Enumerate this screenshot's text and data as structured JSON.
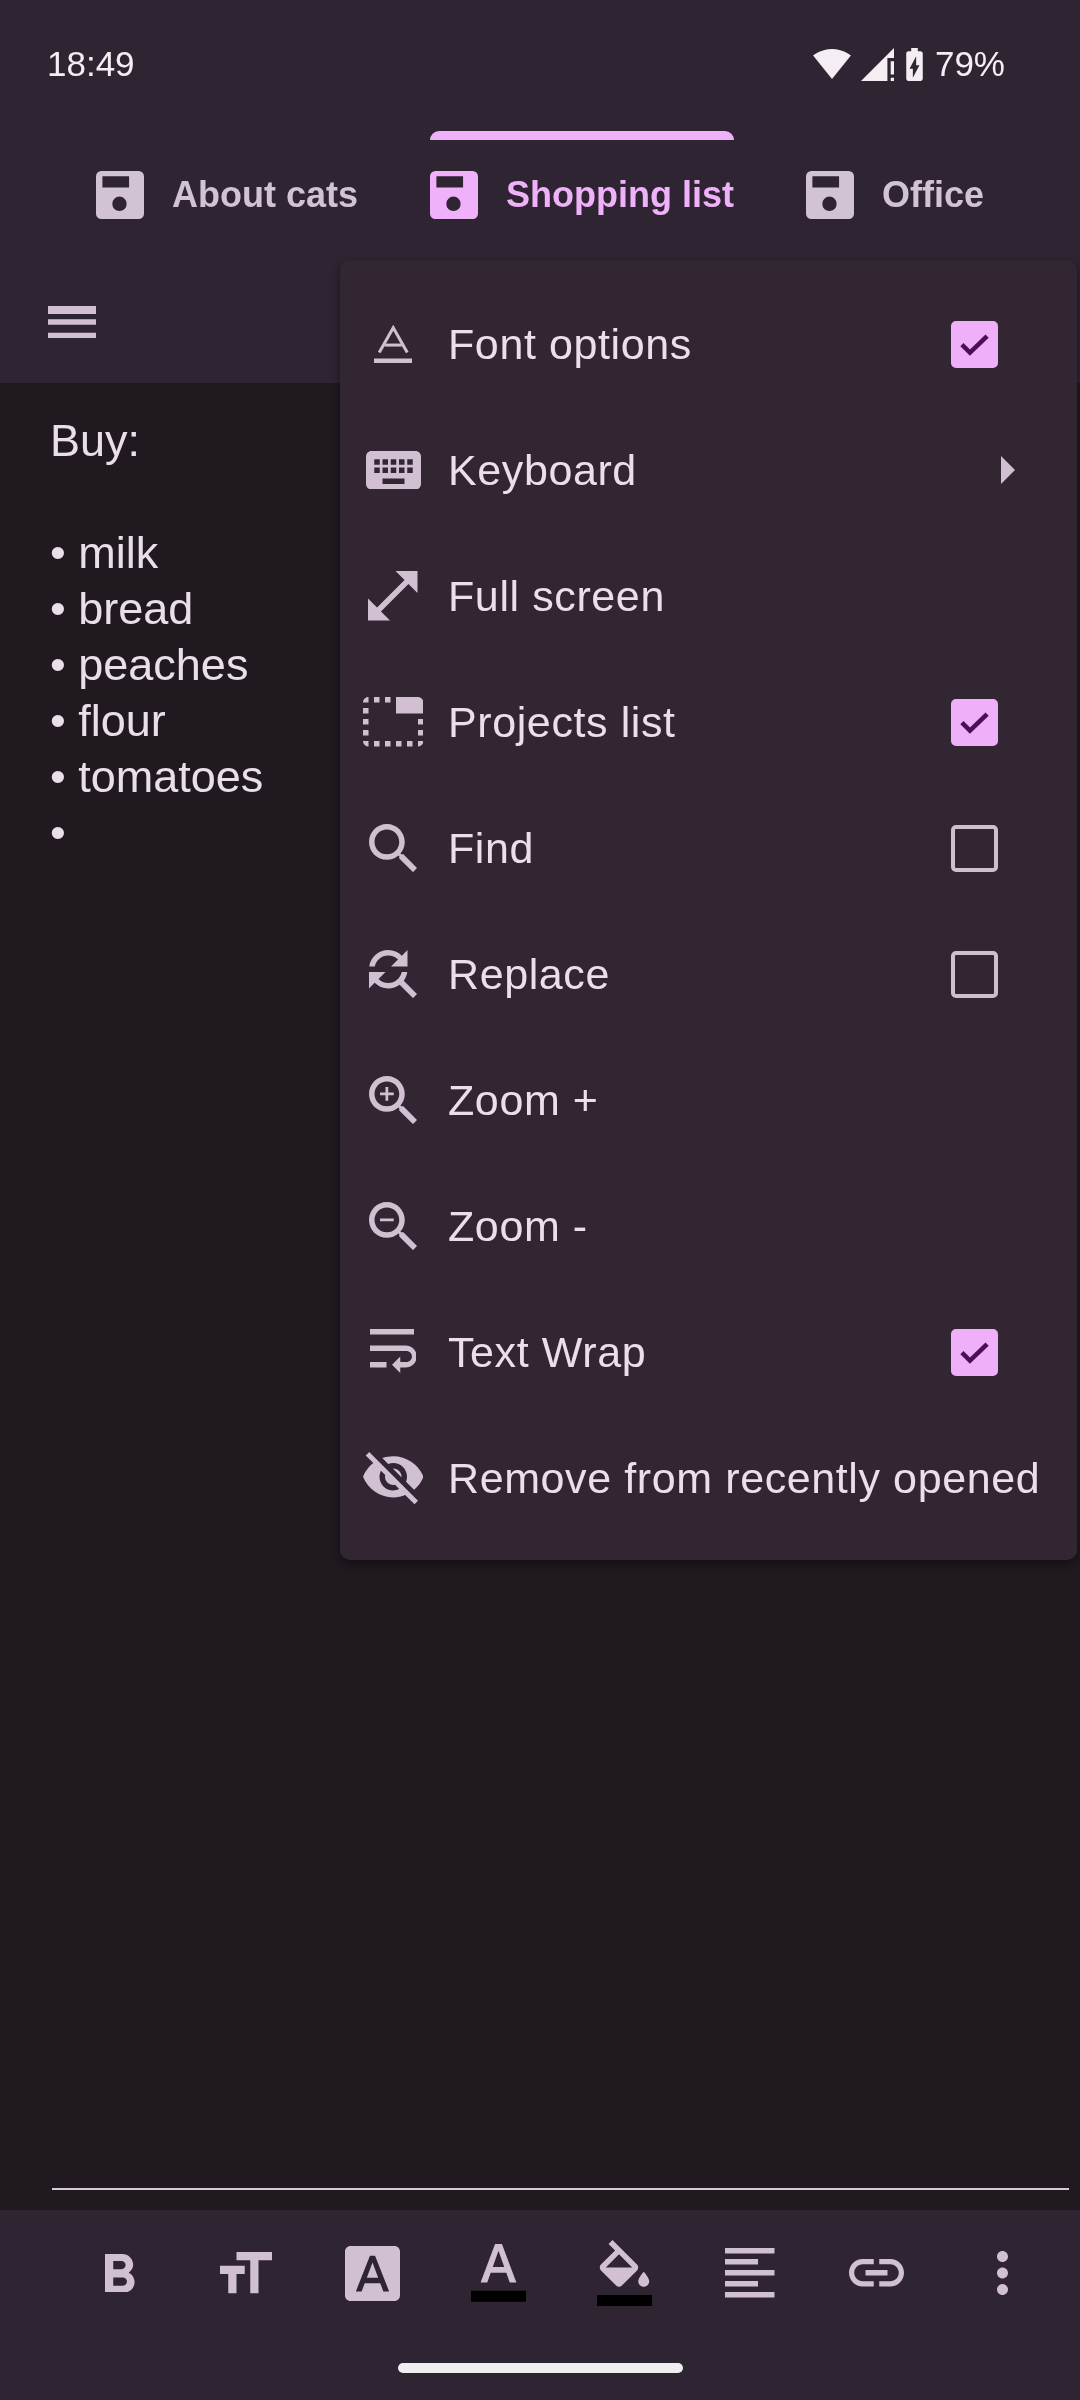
{
  "status_bar": {
    "time": "18:49",
    "battery": "79%"
  },
  "tabs": [
    {
      "label": "About cats",
      "selected": false
    },
    {
      "label": "Shopping list",
      "selected": true
    },
    {
      "label": "Office",
      "selected": false
    }
  ],
  "editor": {
    "text": "Buy:\n\n• milk\n• bread\n• peaches\n• flour\n• tomatoes\n•"
  },
  "menu": {
    "items": [
      {
        "label": "Font options",
        "kind": "checkbox",
        "checked": true
      },
      {
        "label": "Keyboard",
        "kind": "submenu"
      },
      {
        "label": "Full screen",
        "kind": "action"
      },
      {
        "label": "Projects list",
        "kind": "checkbox",
        "checked": true
      },
      {
        "label": "Find",
        "kind": "checkbox",
        "checked": false
      },
      {
        "label": "Replace",
        "kind": "checkbox",
        "checked": false
      },
      {
        "label": "Zoom +",
        "kind": "action"
      },
      {
        "label": "Zoom -",
        "kind": "action"
      },
      {
        "label": "Text Wrap",
        "kind": "checkbox",
        "checked": true
      },
      {
        "label": "Remove from recently opened",
        "kind": "action"
      }
    ]
  }
}
